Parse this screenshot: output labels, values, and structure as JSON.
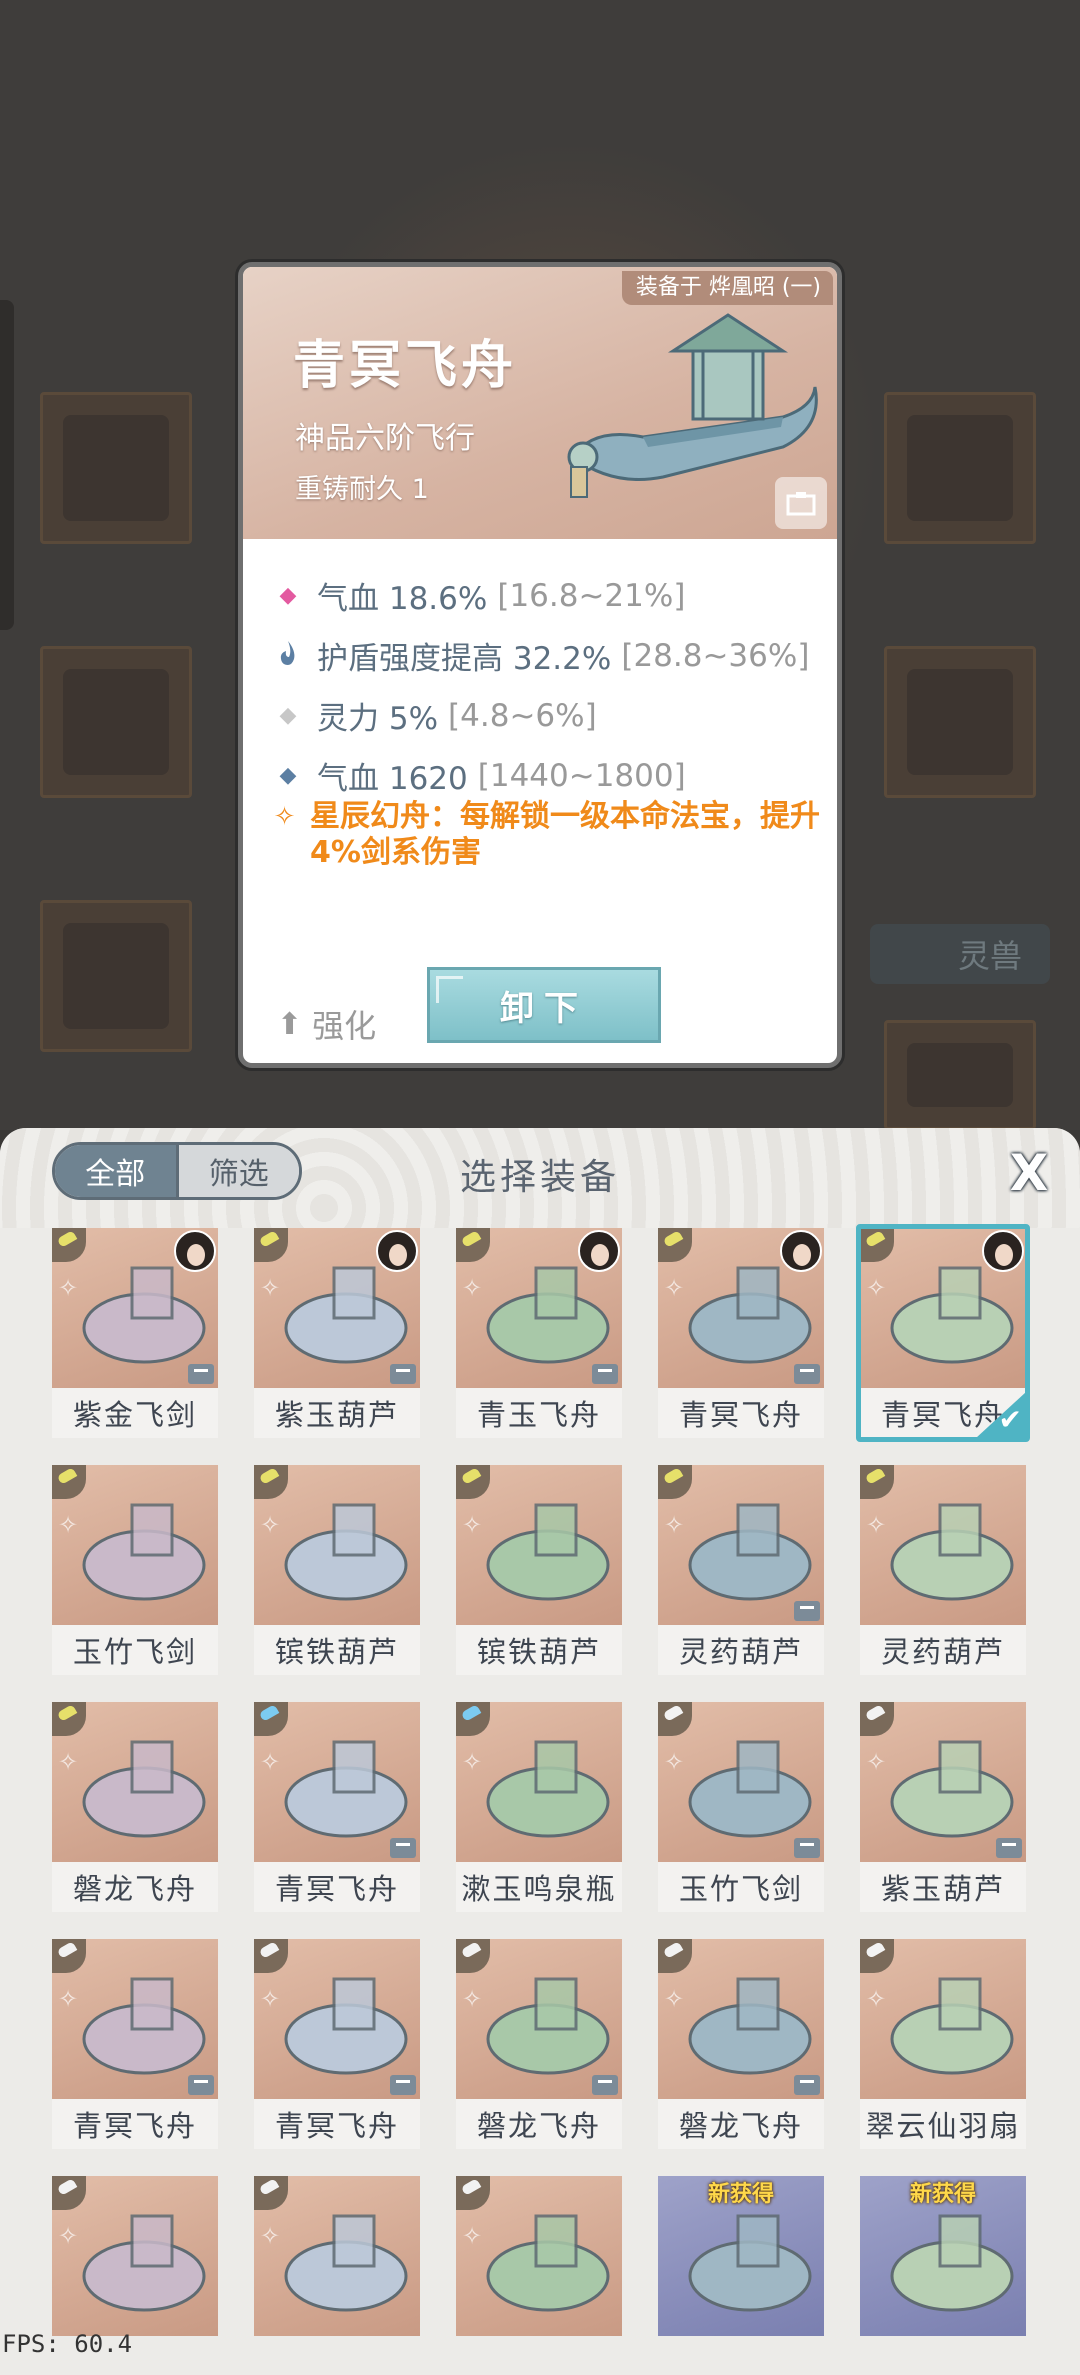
{
  "detail": {
    "equipped_on": "装备于 烨凰昭 (一)",
    "name": "青冥飞舟",
    "grade": "神品六阶飞行",
    "durability": "重铸耐久 1",
    "stats": [
      {
        "icon": "pink-diamond-icon",
        "color": "#e35aa0",
        "text": "气血 18.6%",
        "range": "[16.8~21%]"
      },
      {
        "icon": "flame-icon",
        "color": "#5c7fa3",
        "text": "护盾强度提高 32.2%",
        "range": "[28.8~36%]"
      },
      {
        "icon": "gray-diamond-icon",
        "color": "#c7c7c7",
        "text": "灵力 5%",
        "range": "[4.8~6%]"
      },
      {
        "icon": "blue-diamond-icon",
        "color": "#5c7fa3",
        "text": "气血 1620",
        "range": "[1440~1800]"
      }
    ],
    "special": "星辰幻舟：每解锁一级本命法宝，提升4%剑系伤害",
    "enhance_label": "强化",
    "unequip_label": "卸下"
  },
  "panel": {
    "tab_all": "全部",
    "tab_filter": "筛选",
    "title": "选择装备",
    "close_glyph": "X"
  },
  "items": [
    {
      "name": "紫金飞剑",
      "tier": "gold",
      "owner": true,
      "lock": true
    },
    {
      "name": "紫玉葫芦",
      "tier": "gold",
      "owner": true,
      "lock": true
    },
    {
      "name": "青玉飞舟",
      "tier": "gold",
      "owner": true,
      "lock": true
    },
    {
      "name": "青冥飞舟",
      "tier": "gold",
      "owner": true,
      "lock": true
    },
    {
      "name": "青冥飞舟",
      "tier": "gold",
      "owner": true,
      "lock": false,
      "selected": true
    },
    {
      "name": "玉竹飞剑",
      "tier": "gold",
      "owner": false,
      "lock": false
    },
    {
      "name": "镔铁葫芦",
      "tier": "gold",
      "owner": false,
      "lock": false
    },
    {
      "name": "镔铁葫芦",
      "tier": "gold",
      "owner": false,
      "lock": false
    },
    {
      "name": "灵药葫芦",
      "tier": "gold",
      "owner": false,
      "lock": true
    },
    {
      "name": "灵药葫芦",
      "tier": "gold",
      "owner": false,
      "lock": false
    },
    {
      "name": "磐龙飞舟",
      "tier": "gold",
      "owner": false,
      "lock": false
    },
    {
      "name": "青冥飞舟",
      "tier": "blue",
      "owner": false,
      "lock": true
    },
    {
      "name": "漱玉鸣泉瓶",
      "tier": "blue",
      "owner": false,
      "lock": false
    },
    {
      "name": "玉竹飞剑",
      "tier": "white",
      "owner": false,
      "lock": true
    },
    {
      "name": "紫玉葫芦",
      "tier": "white",
      "owner": false,
      "lock": true
    },
    {
      "name": "青冥飞舟",
      "tier": "white",
      "owner": false,
      "lock": true
    },
    {
      "name": "青冥飞舟",
      "tier": "white",
      "owner": false,
      "lock": true
    },
    {
      "name": "磐龙飞舟",
      "tier": "white",
      "owner": false,
      "lock": true
    },
    {
      "name": "磐龙飞舟",
      "tier": "white",
      "owner": false,
      "lock": true
    },
    {
      "name": "翠云仙羽扇",
      "tier": "white",
      "owner": false,
      "lock": false
    },
    {
      "name": "",
      "tier": "white",
      "owner": false,
      "lock": false
    },
    {
      "name": "",
      "tier": "white",
      "owner": false,
      "lock": false
    },
    {
      "name": "",
      "tier": "white",
      "owner": false,
      "lock": false
    },
    {
      "name": "",
      "tier": "none",
      "owner": false,
      "lock": false,
      "new_tag": "新获得"
    },
    {
      "name": "",
      "tier": "none",
      "owner": false,
      "lock": false,
      "new_tag": "新获得"
    }
  ],
  "fps": "FPS: 60.4"
}
